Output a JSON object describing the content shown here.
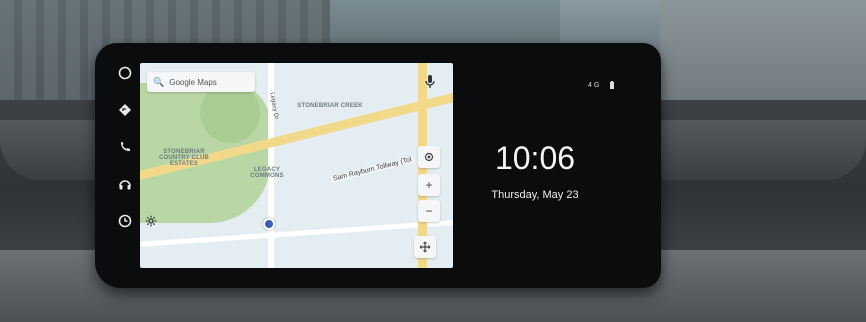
{
  "map": {
    "search_placeholder": "Google Maps",
    "labels": {
      "stonebriar_creek": "STONEBRIAR CREEK",
      "stonebriar_country_club": "STONEBRIAR COUNTRY CLUB ESTATES",
      "legacy_commons": "LEGACY COMMONS",
      "legacy_dr": "Legacy Dr",
      "sam_rayburn": "Sam Rayburn Tollway (Tol"
    },
    "zoom_in": "+",
    "zoom_out": "−"
  },
  "rail": {
    "items": [
      {
        "icon": "circle-icon"
      },
      {
        "icon": "navigation-icon"
      },
      {
        "icon": "phone-icon"
      },
      {
        "icon": "headphones-icon"
      },
      {
        "icon": "clock-icon"
      }
    ]
  },
  "status": {
    "signal_text": "4G"
  },
  "clock": {
    "time": "10:06",
    "date": "Thursday, May 23"
  }
}
